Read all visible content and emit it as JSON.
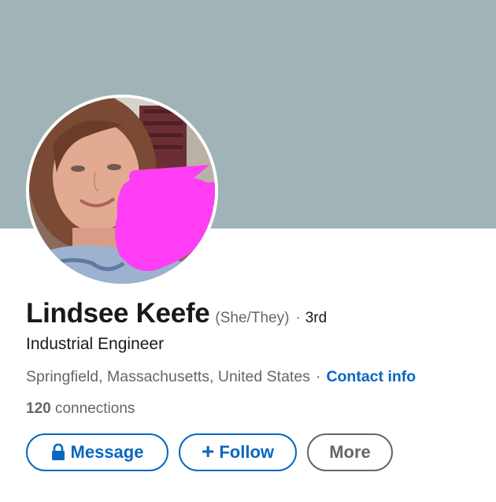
{
  "profile": {
    "name": "Lindsee Keefe",
    "pronouns": "(She/They)",
    "degree_separator": "·",
    "degree": "3rd",
    "headline": "Industrial Engineer",
    "location": "Springfield, Massachusetts, United States",
    "location_separator": "·",
    "contact_info_label": "Contact info",
    "connections_count": "120",
    "connections_label": "connections"
  },
  "actions": {
    "message_label": "Message",
    "follow_label": "Follow",
    "follow_prefix": "+",
    "more_label": "More"
  },
  "colors": {
    "banner": "#a0b4b7",
    "accent": "#0a66c2",
    "text_primary": "#191919",
    "text_secondary": "#666666",
    "redaction": "#ff3df5"
  },
  "icons": {
    "message": "lock-icon",
    "follow": "plus-icon"
  }
}
